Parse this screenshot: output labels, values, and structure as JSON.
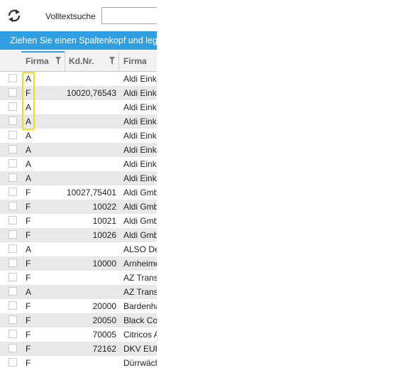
{
  "toolbar": {
    "refresh_icon": "refresh-icon",
    "search_label": "Volltextsuche",
    "search_value": ""
  },
  "group_panel": {
    "text": "Ziehen Sie einen Spaltenkopf und legen"
  },
  "columns": [
    {
      "label": "Firma",
      "filter": true
    },
    {
      "label": "Kd.Nr.",
      "filter": true
    },
    {
      "label": "Firma",
      "filter": false
    }
  ],
  "rows": [
    {
      "typ": "A",
      "kdnr": "",
      "name": "Aldi Einkauf"
    },
    {
      "typ": "F",
      "kdnr": "10020,76543",
      "name": "Aldi Einkauf"
    },
    {
      "typ": "A",
      "kdnr": "",
      "name": "Aldi Einkauf"
    },
    {
      "typ": "A",
      "kdnr": "",
      "name": "Aldi Einkauf"
    },
    {
      "typ": "A",
      "kdnr": "",
      "name": "Aldi Einkauf"
    },
    {
      "typ": "A",
      "kdnr": "",
      "name": "Aldi Einkauf"
    },
    {
      "typ": "A",
      "kdnr": "",
      "name": "Aldi Einkauf"
    },
    {
      "typ": "A",
      "kdnr": "",
      "name": "Aldi Einkauf"
    },
    {
      "typ": "F",
      "kdnr": "10027,75401",
      "name": "Aldi GmbH"
    },
    {
      "typ": "F",
      "kdnr": "10022",
      "name": "Aldi GmbH"
    },
    {
      "typ": "F",
      "kdnr": "10021",
      "name": "Aldi GmbH"
    },
    {
      "typ": "F",
      "kdnr": "10026",
      "name": "Aldi GmbH"
    },
    {
      "typ": "A",
      "kdnr": "",
      "name": "ALSO Deutschland"
    },
    {
      "typ": "F",
      "kdnr": "10000",
      "name": "Arnheimer"
    },
    {
      "typ": "F",
      "kdnr": "",
      "name": "AZ Transport"
    },
    {
      "typ": "A",
      "kdnr": "",
      "name": "AZ Transport"
    },
    {
      "typ": "F",
      "kdnr": "20000",
      "name": "Bardenhagen"
    },
    {
      "typ": "F",
      "kdnr": "20050",
      "name": "Black Coat"
    },
    {
      "typ": "F",
      "kdnr": "70005",
      "name": "Citricos A"
    },
    {
      "typ": "F",
      "kdnr": "72162",
      "name": "DKV EURO"
    },
    {
      "typ": "F",
      "kdnr": "",
      "name": "Dürrwächter"
    }
  ],
  "colors": {
    "accent": "#2e9fe0",
    "highlight": "#f2dc1c",
    "row_alt": "#e9e9e9"
  }
}
